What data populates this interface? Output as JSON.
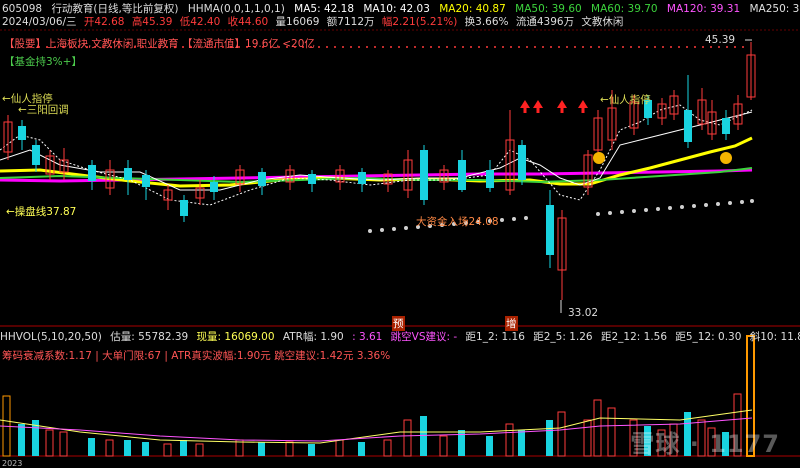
{
  "header": {
    "code": "605098",
    "name_period": "行动教育(日线,等比前复权)",
    "hhma": "HHMA(0,0,1,1,0,1)",
    "ma5": "MA5: 42.18",
    "ma10": "MA10: 42.03",
    "ma20": "MA20: 40.87",
    "ma50": "MA50: 39.60",
    "ma60": "MA60: 39.70",
    "ma120": "MA120: 39.31",
    "ma250": "MA250: 38.01"
  },
  "sub_header": {
    "date": "2024/03/06/三",
    "open": "开42.68",
    "high": "高45.39",
    "low": "低42.40",
    "close": "收44.60",
    "volume": "量16069",
    "amount": "额7112万",
    "change": "幅2.21(5.21%)",
    "turnover": "换3.66%",
    "float": "流通4396万",
    "sector": "文教休闲"
  },
  "tags": {
    "line": "【股要】上海板块,文教休闲,职业教育 【流通市值】19.6亿 <20亿"
  },
  "fund_badge": "【基金持3%+】",
  "annotations": {
    "immortal_left": "←仙人指停",
    "three_yang": "←三阳回调",
    "immortal_right": "←仙人指停",
    "trading_line": "←操盘线37.87",
    "big_funds": "大资金入场24.08",
    "high_price": "45.39",
    "low_price": "33.02",
    "yu_badge": "预",
    "zeng_badge": "增"
  },
  "volume_header": {
    "hhvol": "HHVOL(5,10,20,50)",
    "est_vol": "估量: 55782.39",
    "cur_vol": "现量: 16069.00",
    "atr": "ATR幅: 1.90",
    "atr_extra": ": 3.61",
    "gap_suggest": "跳空VS建议: -",
    "d12": "距1_2: 1.16",
    "d25": "距2_5: 1.26",
    "d212": "距2_12: 1.56",
    "d512": "距5_12: 0.30",
    "slope": "斜10: 11.85"
  },
  "volume_sub": "筹码衰减系数:1.17 | 大单门限:67 | ATR真实波幅:1.90元 跳空建议:1.42元 3.36%",
  "watermark": "雪球 · 1177",
  "bottom_date": "2023",
  "colors": {
    "up": "#ff3b3b",
    "down": "#19d3e0",
    "ma_white": "#ffffff",
    "ma_yellow": "#ffff00",
    "ma_magenta": "#ff00ff",
    "ma_green": "#3cd33c",
    "ma120": "#ff55ff",
    "ma250": "#e0e0e0"
  }
}
